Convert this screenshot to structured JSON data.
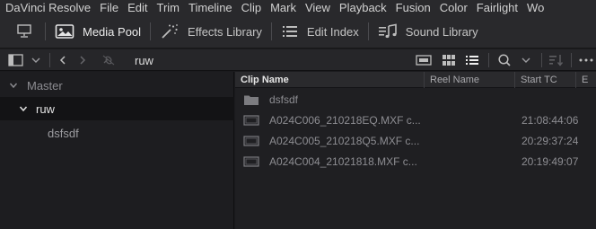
{
  "menu": [
    "DaVinci Resolve",
    "File",
    "Edit",
    "Trim",
    "Timeline",
    "Clip",
    "Mark",
    "View",
    "Playback",
    "Fusion",
    "Color",
    "Fairlight",
    "Wo"
  ],
  "toolbar": {
    "media_pool": "Media Pool",
    "effects_library": "Effects Library",
    "edit_index": "Edit Index",
    "sound_library": "Sound Library"
  },
  "bin_title": "ruw",
  "tree": {
    "master": "Master",
    "bin": "ruw",
    "subbin": "dsfsdf"
  },
  "columns": {
    "clip_name": "Clip Name",
    "reel_name": "Reel Name",
    "start_tc": "Start TC",
    "overflow": "E"
  },
  "clips": [
    {
      "name": "dsfsdf",
      "start_tc": "",
      "icon": "folder-icon"
    },
    {
      "name": "A024C006_210218EQ.MXF c...",
      "start_tc": "21:08:44:06",
      "icon": "video-clip-icon"
    },
    {
      "name": "A024C005_210218Q5.MXF c...",
      "start_tc": "20:29:37:24",
      "icon": "video-clip-icon"
    },
    {
      "name": "A024C004_21021818.MXF c...",
      "start_tc": "20:19:49:07",
      "icon": "video-clip-icon"
    }
  ],
  "colors": {
    "background": "#1b1b1e",
    "toolbar": "#29292c",
    "selected_row": "#131315"
  }
}
